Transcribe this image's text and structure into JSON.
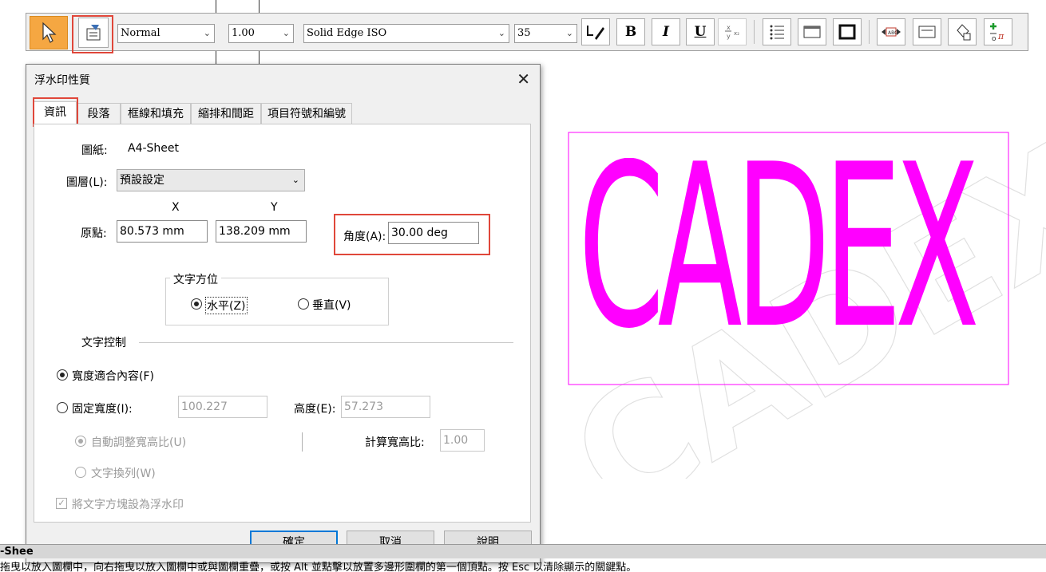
{
  "toolbar": {
    "style_select": "Normal",
    "size_select": "1.00",
    "font_select": "Solid Edge ISO",
    "fontsize_select": "35",
    "bold_label": "B",
    "italic_label": "I",
    "underline_label": "U",
    "icons": [
      "select-arrow-icon",
      "watermark-properties-icon",
      "text-color-icon",
      "bold-icon",
      "italic-icon",
      "underline-icon",
      "stacked-fraction-icon",
      "bullet-list-icon",
      "text-box-icon",
      "border-icon",
      "fit-width-icon",
      "frame-icon",
      "fill-icon",
      "insert-symbol-icon"
    ]
  },
  "dialog": {
    "title": "浮水印性質",
    "tabs": [
      "資訊",
      "段落",
      "框線和填充",
      "縮排和間距",
      "項目符號和編號"
    ],
    "sheet_label": "圖紙:",
    "sheet_value": "A4-Sheet",
    "layer_label": "圖層(L):",
    "layer_value": "預設設定",
    "x_header": "X",
    "y_header": "Y",
    "origin_label": "原點:",
    "origin_x": "80.573 mm",
    "origin_y": "138.209 mm",
    "angle_label": "角度(A):",
    "angle_value": "30.00 deg",
    "orientation_group": "文字方位",
    "horizontal_label": "水平(Z)",
    "vertical_label": "垂直(V)",
    "text_control_label": "文字控制",
    "fit_width_label": "寬度適合內容(F)",
    "fixed_width_label": "固定寬度(I):",
    "width_value": "100.227",
    "height_label": "高度(E):",
    "height_value": "57.273",
    "auto_aspect_label": "自動調整寬高比(U)",
    "calc_aspect_label": "計算寬高比:",
    "aspect_value": "1.00",
    "word_wrap_label": "文字換列(W)",
    "set_box_watermark_label": "將文字方塊設為浮水印",
    "ok_label": "確定",
    "cancel_label": "取消",
    "help_label": "說明"
  },
  "canvas": {
    "watermark_text": "CADEX",
    "watermark_color": "#ff00ff"
  },
  "status": {
    "sheet_tab": "-Shee",
    "message": "拖曳以放入圖欄中，向右拖曳以放入圖欄中或與圖欄重疊，或按 Alt 並點擊以放置多邊形圍欄的第一個頂點。按 Esc 以清除顯示的關鍵點。"
  }
}
